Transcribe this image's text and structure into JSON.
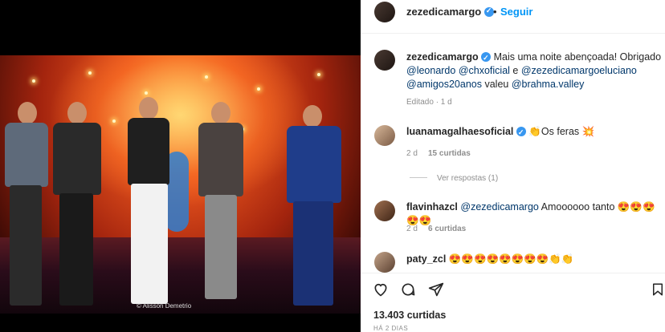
{
  "post": {
    "username": "zezedicamargo",
    "follow_label": "Seguir",
    "separator": "•",
    "photo_credit": "© Alisson Demetrio",
    "caption_text_1": "Mais uma noite abençoada! Obrigado ",
    "caption_mentions": [
      "@leonardo",
      "@chxoficial",
      "@zezedicamargoeluciano",
      "@amigos20anos",
      "@brahma.valley"
    ],
    "caption_and": " e ",
    "caption_valeu": " valeu ",
    "caption_meta": "Editado · 1 d",
    "likes": "13.403 curtidas",
    "time_ago": "HÁ 2 DIAS"
  },
  "comments": [
    {
      "username": "luanamagalhaesoficial",
      "verified": true,
      "text": "👏Os feras 💥",
      "age": "2 d",
      "likes": "15 curtidas",
      "view_replies": "Ver respostas (1)"
    },
    {
      "username": "flavinhazcl",
      "mention": "@zezedicamargo",
      "text": " Amoooooo tanto 😍😍😍😍😍",
      "age": "2 d",
      "likes": "6 curtidas"
    },
    {
      "username": "paty_zcl",
      "text": " 😍😍😍😍😍😍😍😍👏👏"
    }
  ],
  "icons": [
    "heart-icon",
    "comment-icon",
    "share-icon",
    "bookmark-icon"
  ],
  "colors": {
    "link": "#00376b",
    "follow": "#0095f6",
    "verified": "#3897f0",
    "muted": "#8e8e8e"
  }
}
